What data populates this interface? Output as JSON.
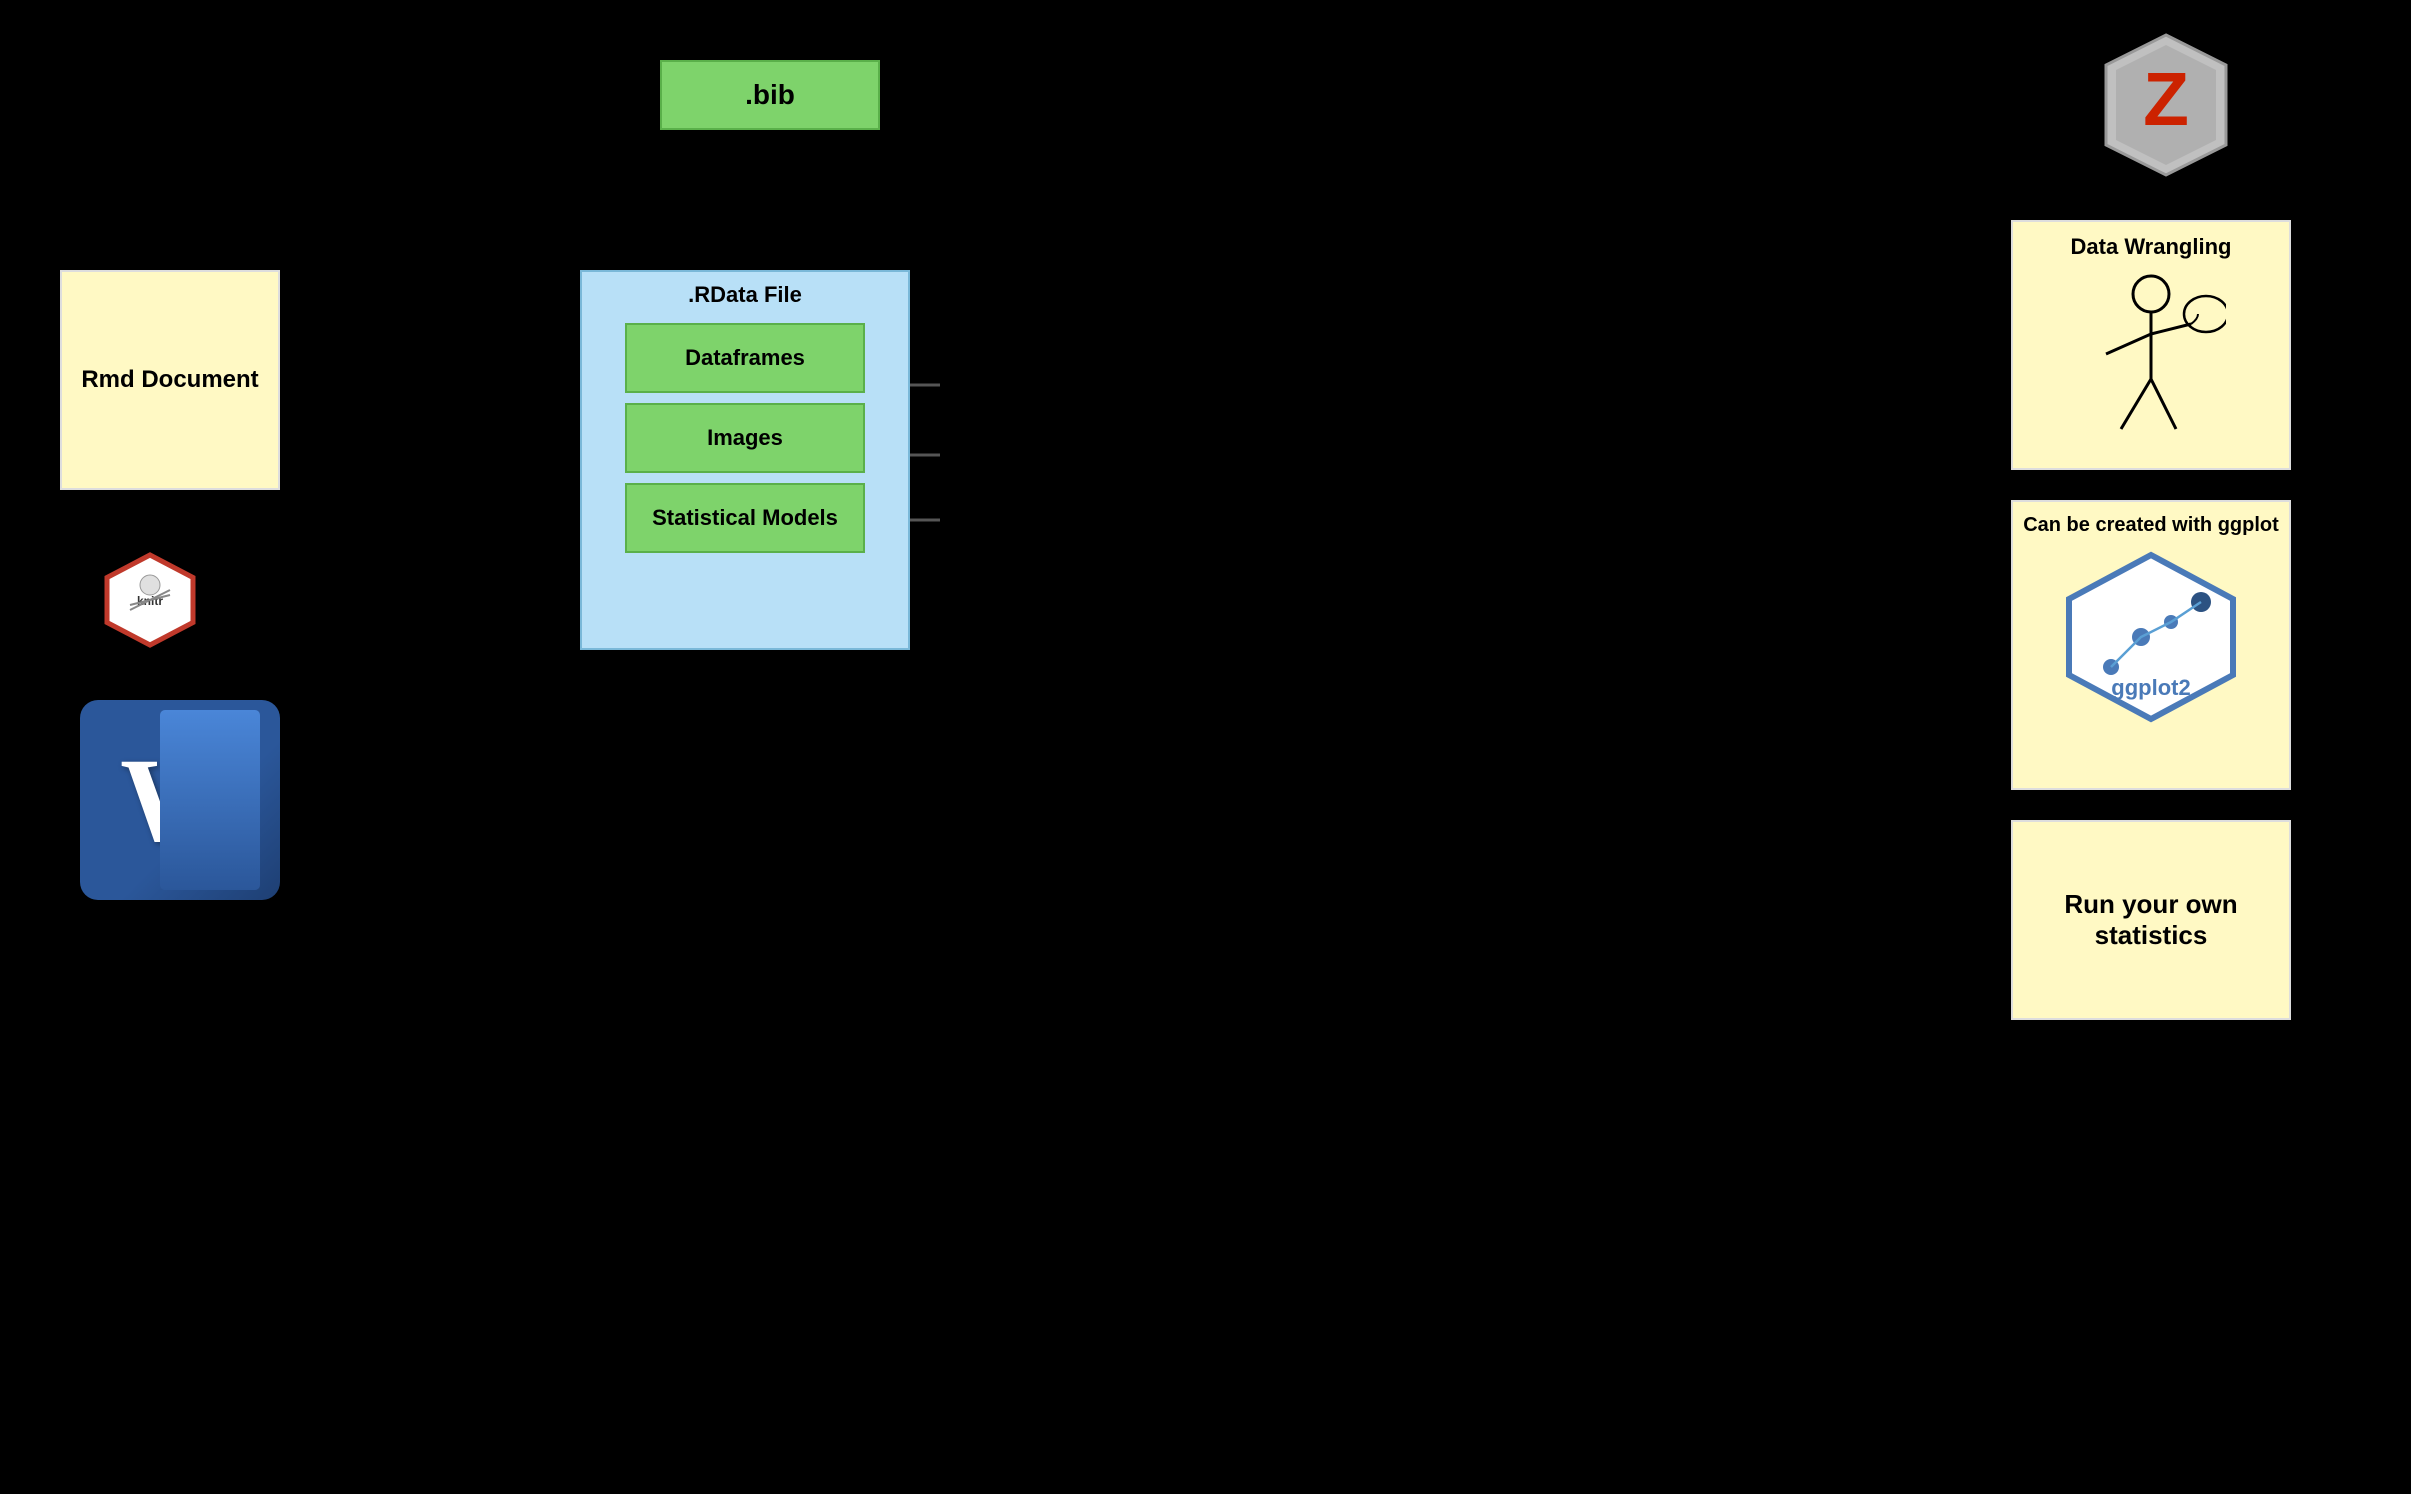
{
  "bib": {
    "label": ".bib"
  },
  "rdata": {
    "title": ".RData File",
    "items": [
      "Dataframes",
      "Images",
      "Statistical Models"
    ]
  },
  "rmd": {
    "label": "Rmd Document"
  },
  "knitr": {
    "label": "knitr"
  },
  "word": {
    "letter": "W"
  },
  "zotero": {
    "label": "Z"
  },
  "dataWrangling": {
    "title": "Data Wrangling"
  },
  "ggplot": {
    "title": "Can be created with ggplot",
    "label": "ggplot2"
  },
  "runStats": {
    "label": "Run your own statistics"
  }
}
